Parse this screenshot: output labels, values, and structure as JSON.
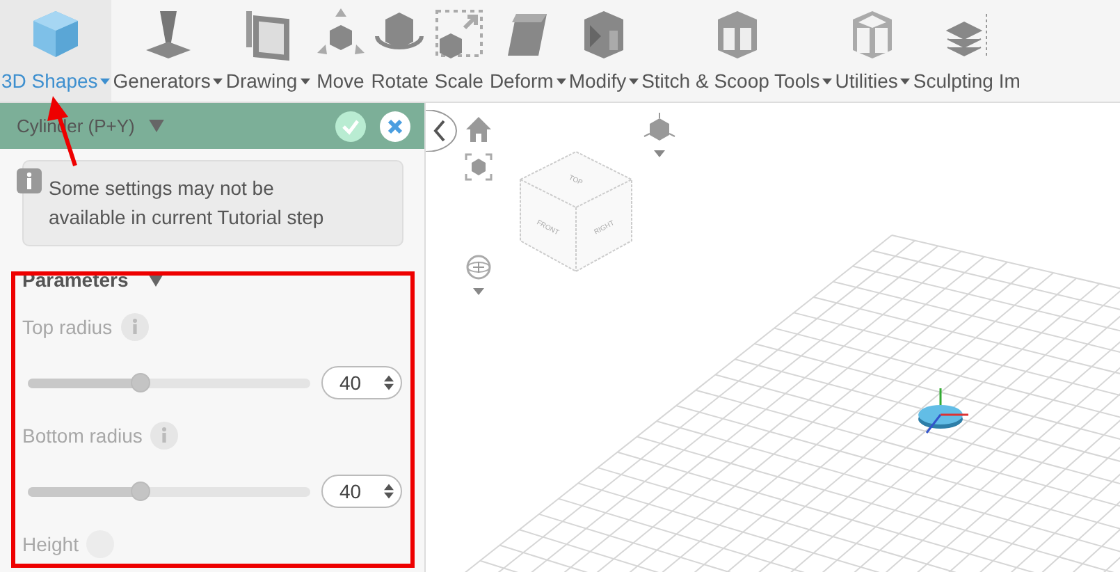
{
  "toolbar": {
    "tools": [
      {
        "label": "3D Shapes",
        "dropdown": true,
        "selected": true
      },
      {
        "label": "Generators",
        "dropdown": true,
        "selected": false
      },
      {
        "label": "Drawing",
        "dropdown": true,
        "selected": false
      },
      {
        "label": "Move",
        "dropdown": false,
        "selected": false
      },
      {
        "label": "Rotate",
        "dropdown": false,
        "selected": false
      },
      {
        "label": "Scale",
        "dropdown": false,
        "selected": false
      },
      {
        "label": "Deform",
        "dropdown": true,
        "selected": false
      },
      {
        "label": "Modify",
        "dropdown": true,
        "selected": false
      },
      {
        "label": "Stitch & Scoop Tools",
        "dropdown": true,
        "selected": false
      },
      {
        "label": "Utilities",
        "dropdown": true,
        "selected": false
      },
      {
        "label": "Sculpting Im",
        "dropdown": false,
        "selected": false
      }
    ]
  },
  "panel": {
    "title": "Cylinder (P+Y)",
    "notice": "Some settings may not be available in current Tutorial step",
    "section": {
      "title": "Parameters",
      "expanded": true,
      "params": [
        {
          "label": "Top radius",
          "level": 0.4,
          "value": "40"
        },
        {
          "label": "Bottom radius",
          "level": 0.4,
          "value": "40"
        }
      ],
      "next_label": "Height"
    }
  },
  "viewport": {
    "view_cube": {
      "top": "TOP",
      "front": "FRONT",
      "right": "RIGHT"
    }
  }
}
